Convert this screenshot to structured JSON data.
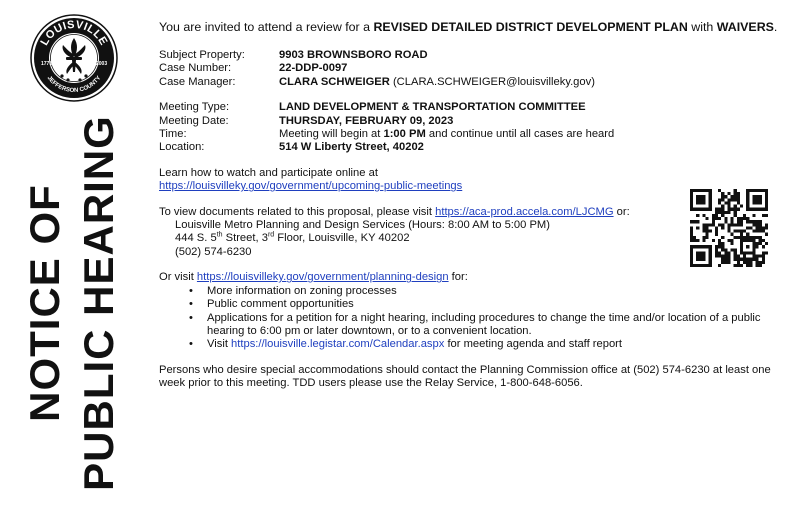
{
  "seal": {
    "top_text": "LOUISVILLE",
    "bottom_text": "JEFFERSON COUNTY",
    "left_year": "1778",
    "right_year": "2003"
  },
  "side_title": {
    "line1": "NOTICE OF",
    "line2": "PUBLIC HEARING"
  },
  "intro": {
    "prefix": "You are invited to attend a review for a ",
    "bold": "REVISED DETAILED DISTRICT DEVELOPMENT PLAN",
    "middle": " with ",
    "bold2": "WAIVERS",
    "suffix": "."
  },
  "case": {
    "subject_property_label": "Subject Property:",
    "subject_property": "9903 BROWNSBORO ROAD",
    "case_number_label": "Case Number:",
    "case_number": "22-DDP-0097",
    "case_manager_label": "Case Manager:",
    "case_manager": "CLARA SCHWEIGER",
    "case_manager_email": " (CLARA.SCHWEIGER@louisvilleky.gov)"
  },
  "meeting": {
    "type_label": "Meeting Type:",
    "type": "LAND DEVELOPMENT & TRANSPORTATION COMMITTEE",
    "date_label": "Meeting Date:",
    "date": "THURSDAY, FEBRUARY 09, 2023",
    "time_label": "Time:",
    "time_prefix": "Meeting will begin at ",
    "time_bold": "1:00 PM",
    "time_suffix": " and continue until all cases are heard",
    "location_label": "Location:",
    "location": "514 W Liberty Street, 40202"
  },
  "online": {
    "text": "Learn how to watch and  participate online at",
    "link": "https://louisvilleky.gov/government/upcoming-public-meetings"
  },
  "documents": {
    "prefix": "To view documents related to this proposal, please visit ",
    "link": "https://aca-prod.accela.com/LJCMG",
    "suffix": " or:",
    "office": "Louisville Metro Planning and Design Services (Hours: 8:00 AM to 5:00 PM)",
    "address_a": "444 S. 5",
    "address_sup1": "th",
    "address_b": " Street, 3",
    "address_sup2": "rd",
    "address_c": " Floor, Louisville, KY 40202",
    "phone": "(502) 574-6230"
  },
  "visit": {
    "prefix": "Or visit ",
    "link": "https://louisvilleky.gov/government/planning-design",
    "suffix": " for:",
    "bullets": [
      "More information on zoning processes",
      "Public comment opportunities",
      "Applications for a petition for a night hearing, including procedures to change the time and/or location of a public hearing to 6:00 pm or later downtown, or to a convenient location."
    ],
    "last_bullet_prefix": "Visit ",
    "last_bullet_link": "https://louisville.legistar.com/Calendar.aspx",
    "last_bullet_suffix": " for meeting agenda and staff report"
  },
  "accommodations": "Persons who desire special accommodations should contact the Planning Commission office at (502) 574-6230 at least one week prior to this meeting. TDD users please use the Relay Service, 1-800-648-6056."
}
